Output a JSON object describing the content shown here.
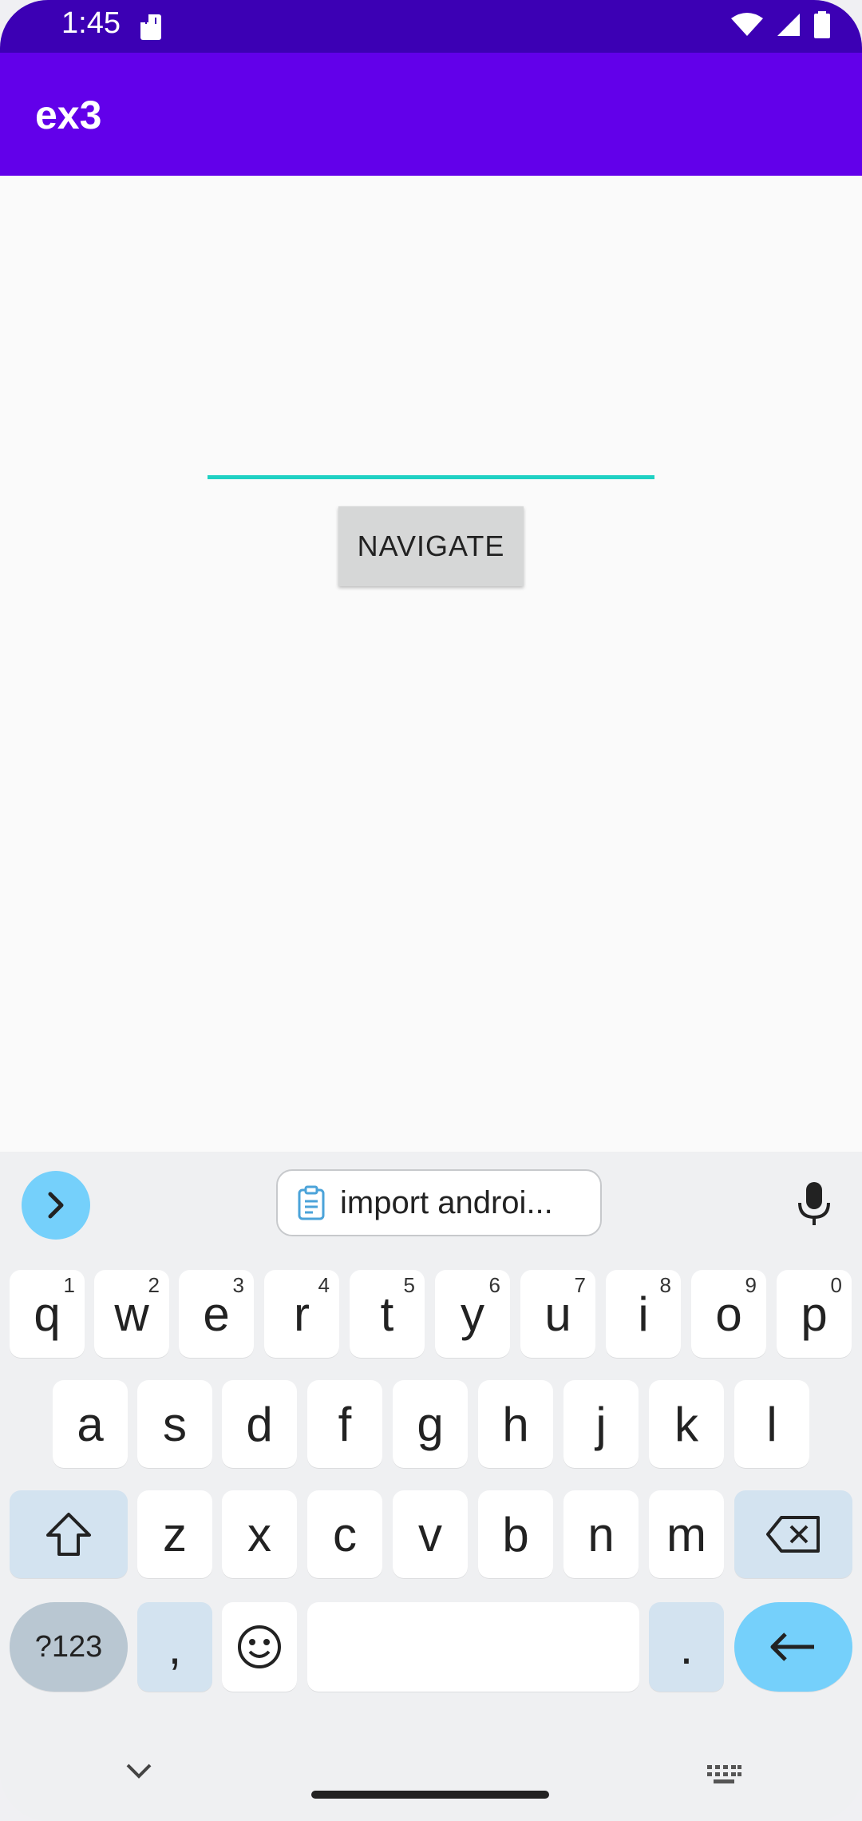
{
  "status_bar": {
    "time": "1:45"
  },
  "app_bar": {
    "title": "ex3"
  },
  "form": {
    "button_label": "NAVIGATE"
  },
  "keyboard": {
    "clipboard_text": "import androi...",
    "row1": [
      {
        "label": "q",
        "hint": "1"
      },
      {
        "label": "w",
        "hint": "2"
      },
      {
        "label": "e",
        "hint": "3"
      },
      {
        "label": "r",
        "hint": "4"
      },
      {
        "label": "t",
        "hint": "5"
      },
      {
        "label": "y",
        "hint": "6"
      },
      {
        "label": "u",
        "hint": "7"
      },
      {
        "label": "i",
        "hint": "8"
      },
      {
        "label": "o",
        "hint": "9"
      },
      {
        "label": "p",
        "hint": "0"
      }
    ],
    "row2": [
      "a",
      "s",
      "d",
      "f",
      "g",
      "h",
      "j",
      "k",
      "l"
    ],
    "row3": [
      "z",
      "x",
      "c",
      "v",
      "b",
      "n",
      "m"
    ],
    "symbols_label": "?123",
    "comma_label": ",",
    "period_label": ".",
    "accent_color": "#75d0fb"
  },
  "colors": {
    "status_bar": "#3c00b4",
    "app_bar": "#6200ea",
    "input_underline": "#1fd1c3"
  }
}
